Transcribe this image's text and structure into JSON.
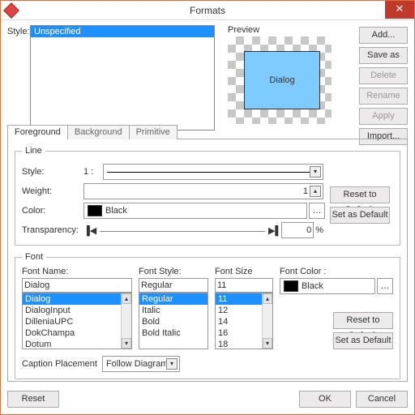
{
  "window": {
    "title": "Formats"
  },
  "styleSection": {
    "label": "Style:",
    "items": [
      "Unspecified"
    ]
  },
  "preview": {
    "label": "Preview",
    "shape_text": "Dialog"
  },
  "sideButtons": {
    "add": "Add...",
    "saveAs": "Save as",
    "delete": "Delete",
    "rename": "Rename",
    "apply": "Apply",
    "import": "Import..."
  },
  "tabs": {
    "foreground": "Foreground",
    "background": "Background",
    "primitive": "Primitive"
  },
  "line": {
    "legend": "Line",
    "style_label": "Style:",
    "style_value": "1 :",
    "weight_label": "Weight:",
    "weight_value": "1",
    "color_label": "Color:",
    "color_name": "Black",
    "transparency_label": "Transparency:",
    "transparency_value": "0",
    "transparency_unit": "%"
  },
  "defaults": {
    "reset": "Reset to Default",
    "set": "Set as Default"
  },
  "font": {
    "legend": "Font",
    "name_label": "Font Name:",
    "name_value": "Dialog",
    "name_list": [
      "Dialog",
      "DialogInput",
      "DilleniaUPC",
      "DokChampa",
      "Dotum"
    ],
    "style_label": "Font Style:",
    "style_value": "Regular",
    "style_list": [
      "Regular",
      "Italic",
      "Bold",
      "Bold Italic"
    ],
    "size_label": "Font Size",
    "size_value": "11",
    "size_list": [
      "11",
      "12",
      "14",
      "16",
      "18"
    ],
    "color_label": "Font Color :",
    "color_name": "Black",
    "caption_label": "Caption Placement",
    "caption_value": "Follow Diagram"
  },
  "bottom": {
    "reset": "Reset",
    "ok": "OK",
    "cancel": "Cancel"
  }
}
